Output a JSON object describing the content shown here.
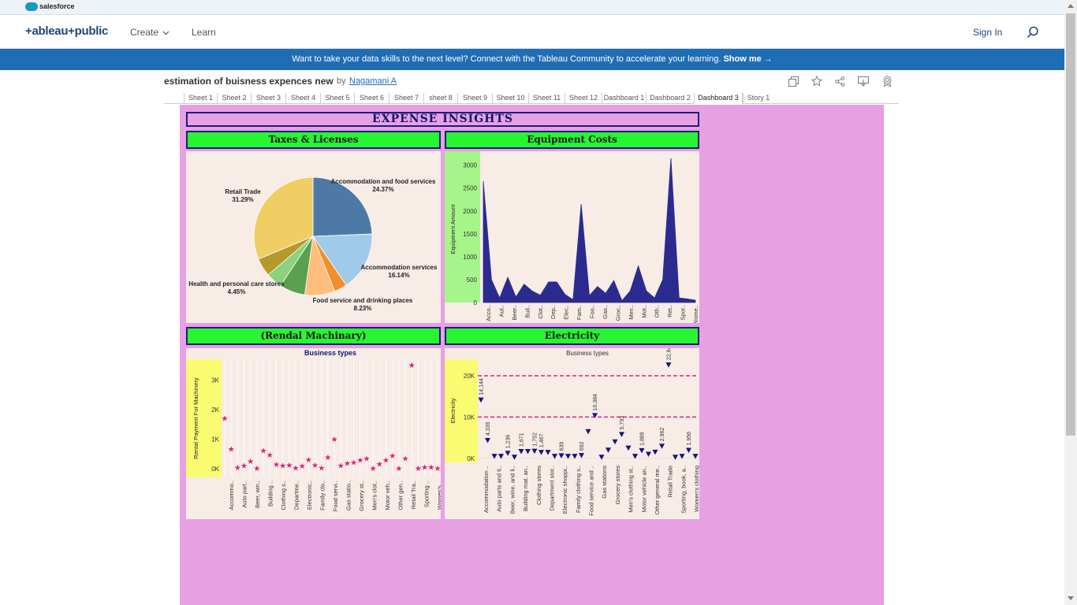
{
  "topbar": {
    "brand": "salesforce"
  },
  "header": {
    "logo": "+ableau+public",
    "nav": [
      {
        "label": "Create"
      },
      {
        "label": "Learn"
      }
    ],
    "sign_in": "Sign In",
    "search_icon": "search-icon"
  },
  "banner": {
    "text": "Want to take your data skills to the next level? Connect with the Tableau Community to accelerate your learning.",
    "link": "Show me →"
  },
  "viz": {
    "title": "estimation of buisness expences new",
    "by": "by",
    "author": "Nagamani A",
    "toolbar_icons": [
      "copy-icon",
      "star-icon",
      "share-icon",
      "download-icon",
      "badge-icon"
    ]
  },
  "tabs": [
    "Sheet 1",
    "Sheet 2",
    "Sheet 3",
    "Sheet 4",
    "Sheet 5",
    "Sheet 6",
    "Sheet 7",
    "sheet 8",
    "Sheet 9",
    "Sheet 10",
    "Sheet 11",
    "Sheet 12",
    "Dashboard 1",
    "Dashboard 2",
    "Dashboard 3",
    "Story 1"
  ],
  "active_tab": "Dashboard 3",
  "dashboard": {
    "title": "EXPENSE INSIGHTS",
    "background": "#e7a0e2",
    "panels": {
      "taxes": "Taxes & Licenses",
      "equipment": "Equipment Costs",
      "rental": "(Rendal Machinary)",
      "electricity": "Electricity"
    }
  },
  "chart_data": [
    {
      "type": "pie",
      "title": "Taxes & Licenses",
      "slices": [
        {
          "label": "Accommodation and food services",
          "pct": 24.37,
          "display": "24.37%",
          "color": "#4e79a7",
          "labeled": true
        },
        {
          "label": "Accommodation services",
          "pct": 16.14,
          "display": "16.14%",
          "color": "#a0cbe8",
          "labeled": true
        },
        {
          "label": "",
          "pct": 3.5,
          "display": "",
          "color": "#f28e2b",
          "labeled": false
        },
        {
          "label": "Food service and drinking places",
          "pct": 8.23,
          "display": "8.23%",
          "color": "#ffbe7d",
          "labeled": true
        },
        {
          "label": "",
          "pct": 7.0,
          "display": "",
          "color": "#59a14f",
          "labeled": false
        },
        {
          "label": "Health and personal care stores",
          "pct": 4.45,
          "display": "4.45%",
          "color": "#8cd17d",
          "labeled": true
        },
        {
          "label": "",
          "pct": 5.0,
          "display": "",
          "color": "#b6992d",
          "labeled": false
        },
        {
          "label": "Retail Trade",
          "pct": 31.29,
          "display": "31.29%",
          "color": "#f1ce63",
          "labeled": true
        }
      ]
    },
    {
      "type": "area",
      "title": "Equipment Costs",
      "ylabel": "Equipment Amount",
      "ylim": [
        0,
        3200
      ],
      "yticks": [
        0,
        500,
        1000,
        1500,
        2000,
        2500,
        3000
      ],
      "categories": [
        "Acco..",
        "Aut..",
        "Beer..",
        "Buil..",
        "Clot..",
        "Dep..",
        "Elec..",
        "Fam..",
        "Foo..",
        "Gas..",
        "Groc..",
        "Men..",
        "Mot..",
        "Oth..",
        "Ret..",
        "Spor..",
        "Wome.."
      ],
      "values": [
        2650,
        500,
        100,
        550,
        120,
        400,
        250,
        160,
        450,
        450,
        180,
        60,
        2150,
        150,
        350,
        200,
        480,
        40,
        250,
        800,
        250,
        100,
        500,
        3150,
        100,
        80,
        50
      ],
      "color": "#2b2b8f"
    },
    {
      "type": "scatter",
      "title": "Business types",
      "ylabel": "Rental Payment For Machinery",
      "ylim": [
        -300,
        3700
      ],
      "yticks": [
        0,
        1000,
        2000,
        3000
      ],
      "ytick_labels": [
        "0K",
        "1K",
        "2K",
        "3K"
      ],
      "categories": [
        "Accommo..",
        "Auto part..",
        "Beer, win..",
        "Building ..",
        "Clothing s..",
        "Departme..",
        "Electronic..",
        "Family clo..",
        "Food servi..",
        "Gas statio..",
        "Grocery st..",
        "Men's clot..",
        "Motor veh..",
        "Other gen..",
        "Retail Tra..",
        "Sporting ..",
        "Women's .."
      ],
      "values": [
        1720,
        680,
        50,
        120,
        260,
        20,
        620,
        480,
        150,
        120,
        130,
        30,
        100,
        310,
        130,
        40,
        400,
        1010,
        120,
        200,
        220,
        300,
        360,
        20,
        170,
        300,
        450,
        20,
        350,
        3520,
        20,
        60,
        60,
        20
      ],
      "color": "#e0217a"
    },
    {
      "type": "scatter",
      "title": "Business types",
      "ylabel": "Electricity",
      "ylim": [
        -1000,
        24000
      ],
      "yticks": [
        0,
        10000,
        20000
      ],
      "ytick_labels": [
        "0K",
        "10K",
        "20K"
      ],
      "reference_lines": [
        10000,
        20000
      ],
      "categories": [
        "Accommodation ..",
        "Auto parts and ti..",
        "Beer, wine, and li..",
        "Building mat. an..",
        "Clothing stores",
        "Department stor..",
        "Electronic shoppi..",
        "Family clothing s..",
        "Food service and ..",
        "Gas stations",
        "Grocery stores",
        "Men's clothing st..",
        "Motor vehicle an..",
        "Other general me..",
        "Retail Trade",
        "Sporting, book, a..",
        "Women's clothing"
      ],
      "values": [
        14144,
        4335,
        500,
        500,
        1236,
        300,
        1671,
        1671,
        1752,
        1467,
        1467,
        500,
        639,
        500,
        500,
        692,
        6500,
        10384,
        300,
        2000,
        4000,
        5793,
        2500,
        500,
        1889,
        1000,
        1500,
        2962,
        22644,
        300,
        500,
        1956,
        500
      ],
      "data_labels": [
        "14,144",
        "4,335",
        "1,236",
        "1,671",
        "1,752",
        "1,467",
        "639",
        "692",
        "10,384",
        "5,793",
        "1,889",
        "2,962",
        "22,644",
        "1,956"
      ],
      "color": "#14147a",
      "ref_color": "#e0217a"
    }
  ]
}
